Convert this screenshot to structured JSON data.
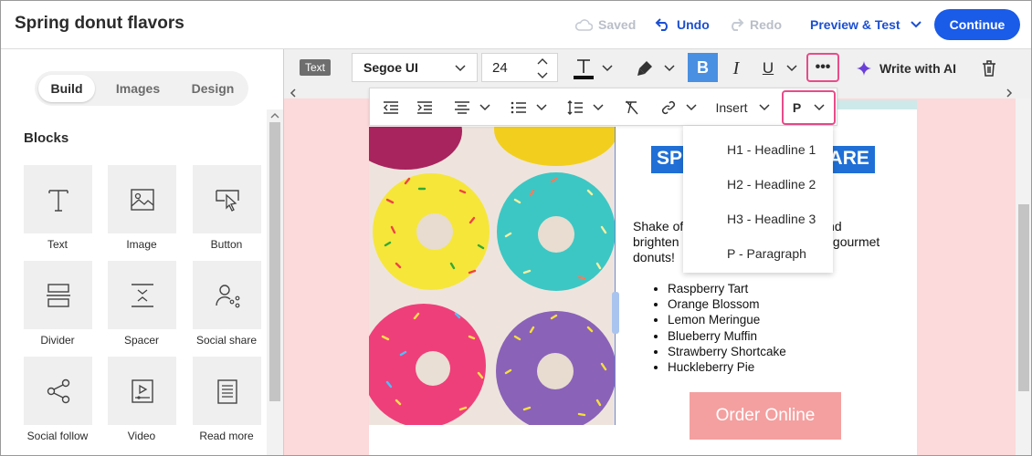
{
  "topbar": {
    "title": "Spring donut flavors",
    "saved": "Saved",
    "undo": "Undo",
    "redo": "Redo",
    "preview": "Preview & Test",
    "continue": "Continue"
  },
  "sidebar": {
    "tabs": [
      "Build",
      "Images",
      "Design"
    ],
    "active_tab": "Build",
    "blocks_title": "Blocks",
    "blocks": [
      "Text",
      "Image",
      "Button",
      "Divider",
      "Spacer",
      "Social share",
      "Social follow",
      "Video",
      "Read more"
    ]
  },
  "toolbar": {
    "element_badge": "Text",
    "font": "Segoe UI",
    "size": "24",
    "bold": "B",
    "italic": "I",
    "underline": "U",
    "more": "•••",
    "write_ai": "Write with AI",
    "insert": "Insert",
    "paragraph": "P"
  },
  "dropdown": {
    "items": [
      "H1 - Headline 1",
      "H2 - Headline 2",
      "H3 - Headline 3",
      "P - Paragraph"
    ]
  },
  "email": {
    "headline_left": "SP",
    "headline_right": "ARE",
    "body_lines": [
      "Shake of",
      "and",
      "brighten",
      "ur gourmet",
      "donuts!"
    ],
    "flavors": [
      "Raspberry Tart",
      "Orange Blossom",
      "Lemon Meringue",
      "Blueberry Muffin",
      "Strawberry Shortcake",
      "Huckleberry Pie"
    ],
    "button": "Order Online"
  },
  "colors": {
    "accent": "#1a5be8",
    "highlight": "#e84b8a",
    "canvas_bg": "#fcd9da",
    "headline_bg": "#1f6fd6",
    "button": "#f4a0a0"
  }
}
